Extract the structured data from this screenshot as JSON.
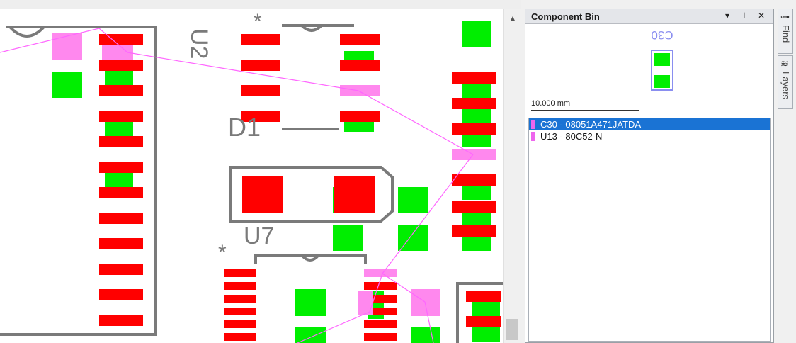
{
  "panel": {
    "title": "Component Bin",
    "buttons": {
      "menu": "▾",
      "pin": "⊥",
      "close": "✕"
    },
    "preview": {
      "designator": "C30"
    },
    "scale_label": "10.000 mm",
    "items": [
      {
        "label": "C30 - 08051A471JATDA",
        "selected": true,
        "color": "#ee66ee"
      },
      {
        "label": "U13 - 80C52-N",
        "selected": false,
        "color": "#ee66ee"
      }
    ]
  },
  "side_tabs": [
    {
      "label": "Find",
      "icon": "binoculars-icon"
    },
    {
      "label": "Layers",
      "icon": "layers-icon"
    }
  ],
  "canvas": {
    "designators": [
      "U2",
      "D1",
      "U7",
      "*",
      "*"
    ]
  },
  "colors": {
    "top_pad": "#ff0000",
    "bottom_pad": "#00ee00",
    "ratsnest": "#ff66ff",
    "silkscreen": "#7a7a7a",
    "selection": "#1a73d4"
  }
}
